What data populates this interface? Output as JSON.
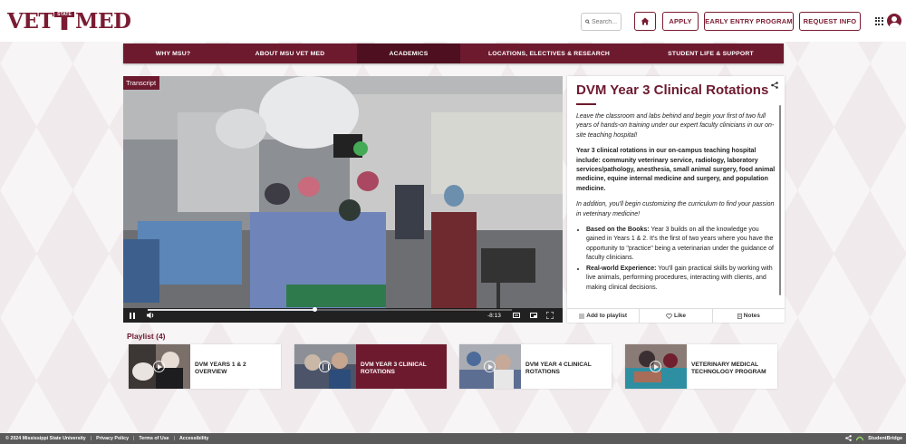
{
  "header": {
    "logo_left": "VET",
    "logo_state": "STATE",
    "logo_right": "MED",
    "search_placeholder": "Search...",
    "home_icon": "home-icon",
    "buttons": [
      "APPLY",
      "EARLY ENTRY PROGRAM",
      "REQUEST INFO"
    ]
  },
  "nav": {
    "items": [
      {
        "label": "WHY MSU?"
      },
      {
        "label": "ABOUT MSU VET MED"
      },
      {
        "label": "ACADEMICS"
      },
      {
        "label": "LOCATIONS, ELECTIVES & RESEARCH"
      },
      {
        "label": "STUDENT LIFE & SUPPORT"
      }
    ],
    "active_item": "ACADEMICS"
  },
  "video": {
    "transcript_label": "Transcript",
    "time_remaining": "-8:13",
    "progress_fraction": 0.46
  },
  "panel": {
    "title": "DVM Year 3 Clinical Rotations",
    "intro": "Leave the classroom and labs behind and begin your first of two full years of hands-on training under our expert faculty clinicians in our on-site teaching hospital!",
    "bold_para": "Year 3 clinical rotations in our on-campus teaching hospital include: community veterinary service, radiology, laboratory services/pathology, anesthesia, small animal surgery, food animal medicine, equine internal medicine and surgery, and population medicine.",
    "italic_para": "In addition, you'll begin customizing the curriculum to find your passion in veterinary medicine!",
    "bullets": [
      {
        "lead": "Based on the Books:",
        "text": " Year 3 builds on all the knowledge you gained in Years 1 & 2. It's the first of two years where you have the opportunity to \"practice\" being a veterinarian under the guidance of faculty clinicians."
      },
      {
        "lead": "Real-world Experience:",
        "text": " You'll gain practical skills by working with live animals, performing procedures, interacting with clients, and making clinical decisions."
      }
    ],
    "actions": [
      "Add to playlist",
      "Like",
      "Notes"
    ]
  },
  "playlist": {
    "title": "Playlist (4)",
    "items": [
      {
        "label": "DVM YEARS 1 & 2 OVERVIEW"
      },
      {
        "label": "DVM YEAR 3 CLINICAL ROTATIONS"
      },
      {
        "label": "DVM YEAR 4 CLINICAL ROTATIONS"
      },
      {
        "label": "VETERINARY MEDICAL TECHNOLOGY PROGRAM"
      }
    ],
    "active_index": 1
  },
  "footer": {
    "copyright": "© 2024 Mississippi State University",
    "links": [
      "Privacy Policy",
      "Terms of Use",
      "Accessibility"
    ],
    "brand": "StudentBridge"
  },
  "colors": {
    "maroon": "#6d1a2f",
    "maroon_dark": "#4e1020",
    "footer_gray": "#5b5b5b"
  }
}
